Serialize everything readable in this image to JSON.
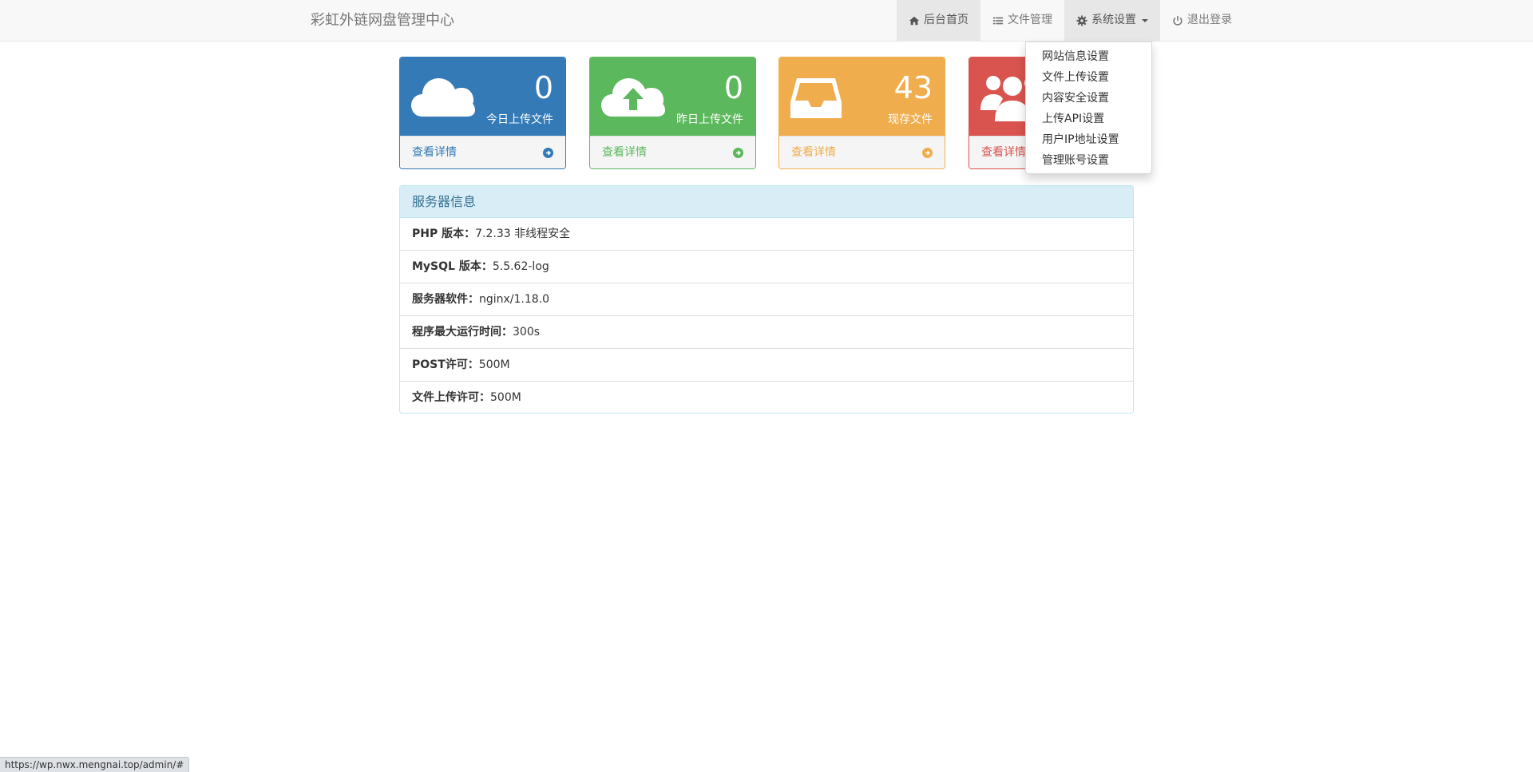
{
  "navbar": {
    "brand": "彩虹外链网盘管理中心",
    "items": [
      {
        "label": "后台首页",
        "icon": "home-icon"
      },
      {
        "label": "文件管理",
        "icon": "list-icon"
      },
      {
        "label": "系统设置",
        "icon": "gear-icon"
      },
      {
        "label": "退出登录",
        "icon": "power-icon"
      }
    ]
  },
  "dropdown": {
    "items": [
      "网站信息设置",
      "文件上传设置",
      "内容安全设置",
      "上传API设置",
      "用户IP地址设置",
      "管理账号设置"
    ]
  },
  "stats": [
    {
      "value": "0",
      "label": "今日上传文件",
      "link": "查看详情",
      "icon": "cloud-icon",
      "color": "#337ab7"
    },
    {
      "value": "0",
      "label": "昨日上传文件",
      "link": "查看详情",
      "icon": "cloud-upload-icon",
      "color": "#5cb85c"
    },
    {
      "value": "43",
      "label": "现存文件",
      "link": "查看详情",
      "icon": "inbox-icon",
      "color": "#f0ad4e"
    },
    {
      "link": "查看详情",
      "icon": "users-icon",
      "color": "#d9534f"
    }
  ],
  "server_info": {
    "title": "服务器信息",
    "rows": [
      {
        "label": "PHP 版本：",
        "value": "7.2.33 非线程安全"
      },
      {
        "label": "MySQL 版本：",
        "value": "5.5.62-log"
      },
      {
        "label": "服务器软件：",
        "value": "nginx/1.18.0"
      },
      {
        "label": "程序最大运行时间：",
        "value": "300s"
      },
      {
        "label": "POST许可：",
        "value": "500M"
      },
      {
        "label": "文件上传许可：",
        "value": "500M"
      }
    ]
  },
  "statusbar": {
    "url": "https://wp.nwx.mengnai.top/admin/#"
  }
}
